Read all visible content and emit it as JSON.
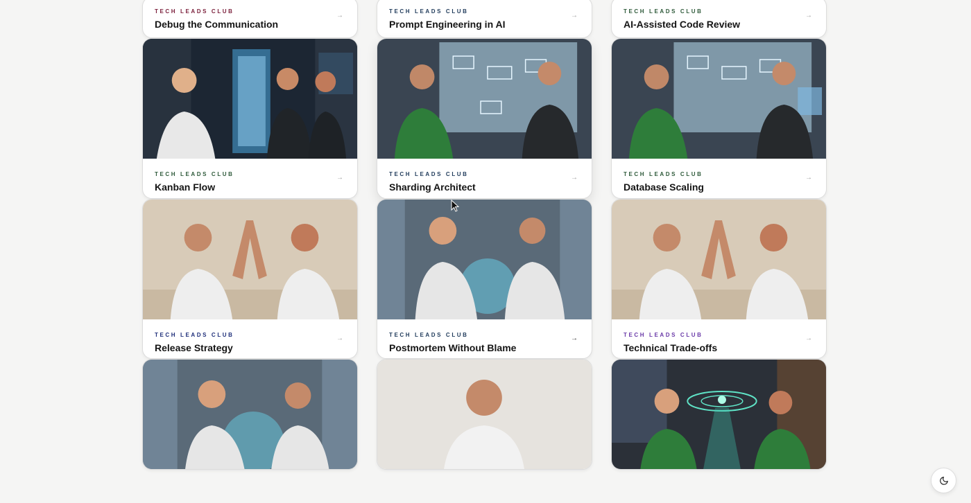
{
  "cards": [
    {
      "eyebrow": "TECH LEADS CLUB",
      "eyebrow_color": "#7a1e3a",
      "title": "Debug the Communication",
      "arrow": "→",
      "image": "none",
      "image_visible": false
    },
    {
      "eyebrow": "TECH LEADS CLUB",
      "eyebrow_color": "#1f3a5a",
      "title": "Prompt Engineering in AI",
      "arrow": "→",
      "image": "none",
      "image_visible": false
    },
    {
      "eyebrow": "TECH LEADS CLUB",
      "eyebrow_color": "#2e5a3a",
      "title": "AI-Assisted Code Review",
      "arrow": "→",
      "image": "none",
      "image_visible": false
    },
    {
      "eyebrow": "TECH LEADS CLUB",
      "eyebrow_color": "#2e5a3a",
      "title": "Kanban Flow",
      "arrow": "→",
      "image": "hologram-building-three-devs",
      "image_visible": true
    },
    {
      "eyebrow": "TECH LEADS CLUB",
      "eyebrow_color": "#1f3a5a",
      "title": "Sharding Architect",
      "arrow": "→",
      "image": "whiteboard-diagram-two-devs",
      "image_visible": true
    },
    {
      "eyebrow": "TECH LEADS CLUB",
      "eyebrow_color": "#2e5a3a",
      "title": "Database Scaling",
      "arrow": "→",
      "image": "whiteboard-diagram-two-devs",
      "image_visible": true
    },
    {
      "eyebrow": "TECH LEADS CLUB",
      "eyebrow_color": "#1f2f7a",
      "title": "Release Strategy",
      "arrow": "→",
      "image": "high-five-two-devs",
      "image_visible": true
    },
    {
      "eyebrow": "TECH LEADS CLUB",
      "eyebrow_color": "#1f3a5a",
      "title": "Postmortem Without Blame",
      "arrow": "→",
      "image": "network-globe-two-devs",
      "image_visible": true
    },
    {
      "eyebrow": "TECH LEADS CLUB",
      "eyebrow_color": "#6a3aa8",
      "title": "Technical Trade-offs",
      "arrow": "→",
      "image": "high-five-two-devs",
      "image_visible": true
    },
    {
      "eyebrow": "",
      "eyebrow_color": "#1f3a5a",
      "title": "",
      "arrow": "",
      "image": "network-globe-two-devs",
      "image_visible": true
    },
    {
      "eyebrow": "",
      "eyebrow_color": "#1f3a5a",
      "title": "",
      "arrow": "",
      "image": "single-dev-portrait",
      "image_visible": true
    },
    {
      "eyebrow": "",
      "eyebrow_color": "#1f3a5a",
      "title": "",
      "arrow": "",
      "image": "office-hologram-two-devs",
      "image_visible": true
    }
  ],
  "theme_toggle": {
    "icon": "moon-icon"
  },
  "colors": {
    "page_bg": "#f5f5f4",
    "card_bg": "#ffffff",
    "title": "#151515"
  }
}
